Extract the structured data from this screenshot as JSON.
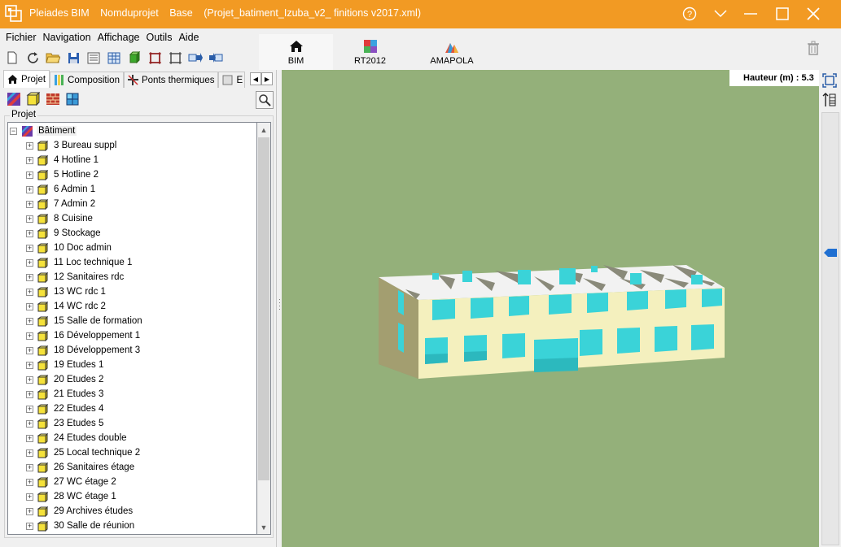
{
  "window": {
    "app_name": "Pleiades BIM",
    "project_name": "Nomduprojet",
    "variant": "Base",
    "file": "(Projet_batiment_Izuba_v2_ finitions v2017.xml)",
    "accent_color": "#f29a23"
  },
  "menu": [
    "Fichier",
    "Navigation",
    "Affichage",
    "Outils",
    "Aide"
  ],
  "toolbar_icons": [
    "new-file-icon",
    "refresh-icon",
    "open-folder-icon",
    "save-icon",
    "list-icon",
    "table-icon",
    "3d-box-icon",
    "frame-icon",
    "crop-icon",
    "export-icon",
    "import-icon"
  ],
  "main_tabs": [
    {
      "label": "BIM",
      "icon": "home-icon",
      "active": true
    },
    {
      "label": "RT2012",
      "icon": "rt2012-icon",
      "active": false
    },
    {
      "label": "AMAPOLA",
      "icon": "amapola-icon",
      "active": false
    }
  ],
  "panel_tabs": [
    {
      "label": "Projet",
      "icon": "home-icon",
      "active": true
    },
    {
      "label": "Composition",
      "icon": "composition-icon",
      "active": false
    },
    {
      "label": "Ponts thermiques",
      "icon": "thermal-bridge-icon",
      "active": false
    },
    {
      "label": "E",
      "icon": "e-tab-icon",
      "active": false
    }
  ],
  "project_group_label": "Projet",
  "tree": {
    "root_label": "Bâtiment",
    "items": [
      "3 Bureau suppl",
      "4 Hotline 1",
      "5 Hotline 2",
      "6 Admin 1",
      "7 Admin 2",
      "8 Cuisine",
      "9 Stockage",
      "10 Doc admin",
      "11 Loc technique 1",
      "12 Sanitaires rdc",
      "13 WC rdc 1",
      "14 WC rdc 2",
      "15 Salle de formation",
      "16 Développement 1",
      "18 Développement 3",
      "19 Etudes 1",
      "20 Etudes 2",
      "21 Etudes 3",
      "22 Etudes 4",
      "23 Etudes 5",
      "24 Etudes double",
      "25 Local technique 2",
      "26 Sanitaires étage",
      "27 WC étage 2",
      "28 WC étage 1",
      "29 Archives études",
      "30 Salle de réunion"
    ]
  },
  "viewport": {
    "height_label": "Hauteur (m) : 5.3",
    "background": "#94b07a",
    "wall_color": "#f4f0be",
    "window_color": "#3ad3d8",
    "height_slider_fraction": 0.32
  }
}
